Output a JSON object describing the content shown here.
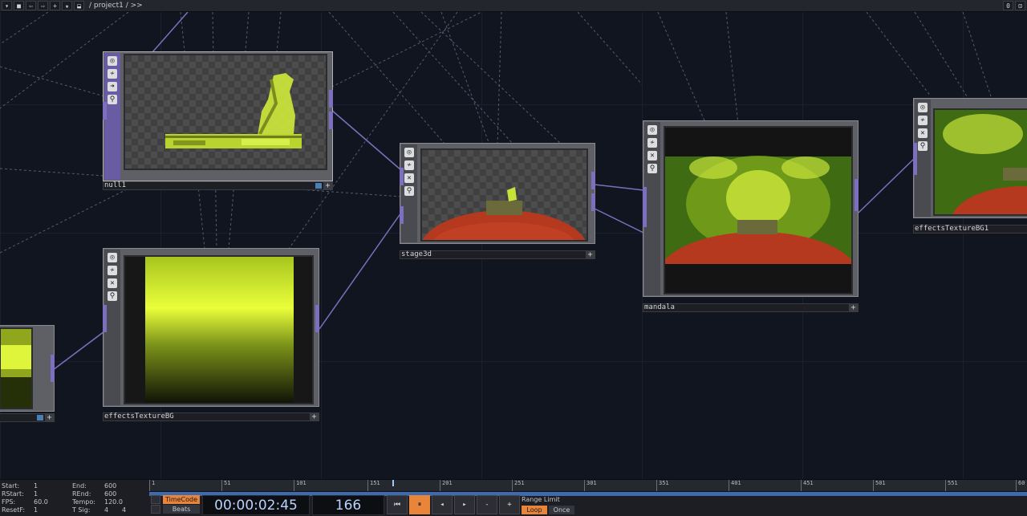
{
  "toolbar": {
    "buttons": [
      "▾",
      "■",
      "⇦",
      "⇨",
      "+",
      "★",
      "⬓"
    ],
    "path": "/ project1 / >>",
    "right": [
      "0",
      "⊡"
    ]
  },
  "nodes": {
    "null1": {
      "label": "null1"
    },
    "stage3d": {
      "label": "stage3d"
    },
    "mandala": {
      "label": "mandala"
    },
    "effectsTextureBG": {
      "label": "effectsTextureBG"
    },
    "effectsTextureBG1": {
      "label": "effectsTextureBG1"
    }
  },
  "node_icons": [
    "◎",
    "≁",
    "✕",
    "⚲"
  ],
  "node_icons_null": [
    "◎",
    "≁",
    "➜",
    "⚲"
  ],
  "plus": "+",
  "stats": {
    "start_label": "Start:",
    "start": "1",
    "rstart_label": "RStart:",
    "rstart": "1",
    "fps_label": "FPS:",
    "fps": "60.0",
    "resetf_label": "ResetF:",
    "resetf": "1",
    "end_label": "End:",
    "end": "600",
    "rend_label": "REnd:",
    "rend": "600",
    "tempo_label": "Tempo:",
    "tempo": "120.0",
    "tsig_label": "T Sig:",
    "tsig_a": "4",
    "tsig_b": "4"
  },
  "ruler": [
    "1",
    "51",
    "101",
    "151",
    "201",
    "251",
    "301",
    "351",
    "401",
    "451",
    "501",
    "551",
    "60"
  ],
  "time": {
    "timecode_label": "TimeCode",
    "beats_label": "Beats",
    "timecode": "00:00:02:45",
    "frame": "166",
    "range_limit": "Range Limit",
    "loop": "Loop",
    "once": "Once"
  },
  "transport": [
    "⏮",
    "⏸",
    "◂",
    "▸",
    "-",
    "+"
  ],
  "colors": {
    "accent": "#e8853a",
    "timeline": "#3e6bb0",
    "wire": "#7c6fbd"
  }
}
